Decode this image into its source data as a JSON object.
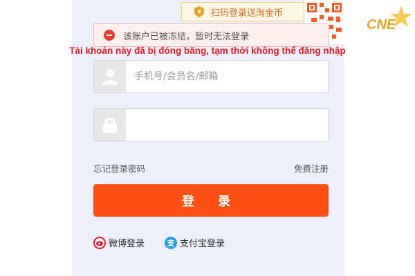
{
  "qr_tip": {
    "text": "扫码登录送淘金币",
    "icon": "shield-icon"
  },
  "error": {
    "message": "该账户已被冻结，暂时无法登录",
    "icon": "minus-circle-icon"
  },
  "caption": "Tài khoản này đã bị đóng băng, tạm thời không thể đăng nhập",
  "form": {
    "username": {
      "placeholder": "手机号/会员名/邮箱",
      "value": "",
      "icon": "user-icon"
    },
    "password": {
      "placeholder": "",
      "value": "",
      "icon": "lock-icon"
    },
    "forgot_label": "忘记登录密码",
    "register_label": "免费注册",
    "login_label": "登 录"
  },
  "third_party": {
    "weibo_label": "微博登录",
    "alipay_label": "支付宝登录",
    "alipay_glyph": "支"
  },
  "logo_text": "CNE",
  "colors": {
    "accent": "#ff4f14",
    "error": "#e53f28",
    "caption": "#e31b23",
    "alipay": "#1ba1e2",
    "weibo": "#e6162d"
  }
}
